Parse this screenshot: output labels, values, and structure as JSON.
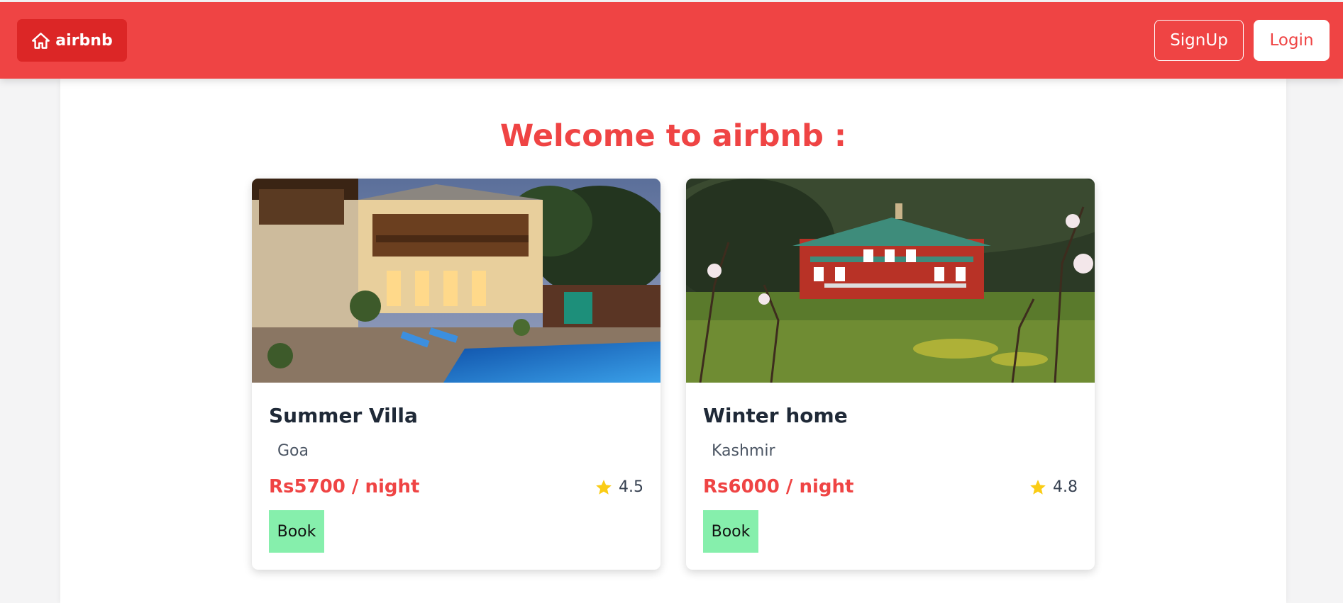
{
  "navbar": {
    "brand_label": "airbnb",
    "brand_icon": "home-icon",
    "signup_label": "SignUp",
    "login_label": "Login"
  },
  "colors": {
    "primary": "#ef4444",
    "brand_bg": "#dc2626",
    "book_button": "#86efac",
    "star": "#facc15"
  },
  "main": {
    "welcome": "Welcome to airbnb :"
  },
  "listings": [
    {
      "title": "Summer Villa",
      "location": "Goa",
      "price": "Rs5700 / night",
      "rating": "4.5",
      "book_label": "Book",
      "image": "villa-with-pool-photo"
    },
    {
      "title": "Winter home",
      "location": "Kashmir",
      "price": "Rs6000 / night",
      "rating": "4.8",
      "book_label": "Book",
      "image": "red-house-in-orchard-photo"
    }
  ]
}
